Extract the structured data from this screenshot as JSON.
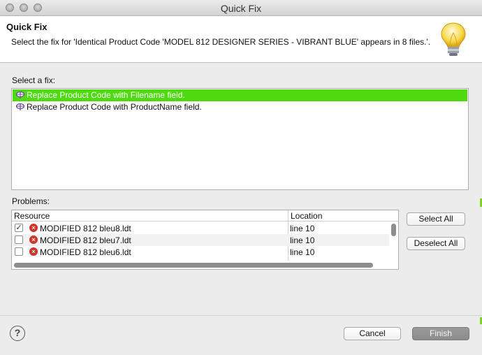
{
  "window": {
    "title": "Quick Fix"
  },
  "header": {
    "title": "Quick Fix",
    "description": "Select the fix for 'Identical Product Code 'MODEL 812 DESIGNER SERIES - VIBRANT BLUE' appears in 8 files.'.",
    "icon": "lightbulb-icon"
  },
  "fixes": {
    "label": "Select a fix:",
    "items": [
      {
        "label": "Replace Product Code with Filename field.",
        "selected": true,
        "icon": "quickfix-icon"
      },
      {
        "label": "Replace Product Code with ProductName field.",
        "selected": false,
        "icon": "quickfix-icon"
      }
    ]
  },
  "problems": {
    "label": "Problems:",
    "columns": [
      "Resource",
      "Location"
    ],
    "rows": [
      {
        "checked": true,
        "resource": "MODIFIED 812 bleu8.ldt",
        "location": "line 10",
        "icon": "error-icon"
      },
      {
        "checked": false,
        "resource": "MODIFIED 812 bleu7.ldt",
        "location": "line 10",
        "icon": "error-icon"
      },
      {
        "checked": false,
        "resource": "MODIFIED 812 bleu6.ldt",
        "location": "line 10",
        "icon": "error-icon"
      }
    ]
  },
  "buttons": {
    "select_all": "Select All",
    "deselect_all": "Deselect All",
    "cancel": "Cancel",
    "finish": "Finish"
  },
  "colors": {
    "selection": "#4fda0f",
    "error": "#d0352b"
  }
}
